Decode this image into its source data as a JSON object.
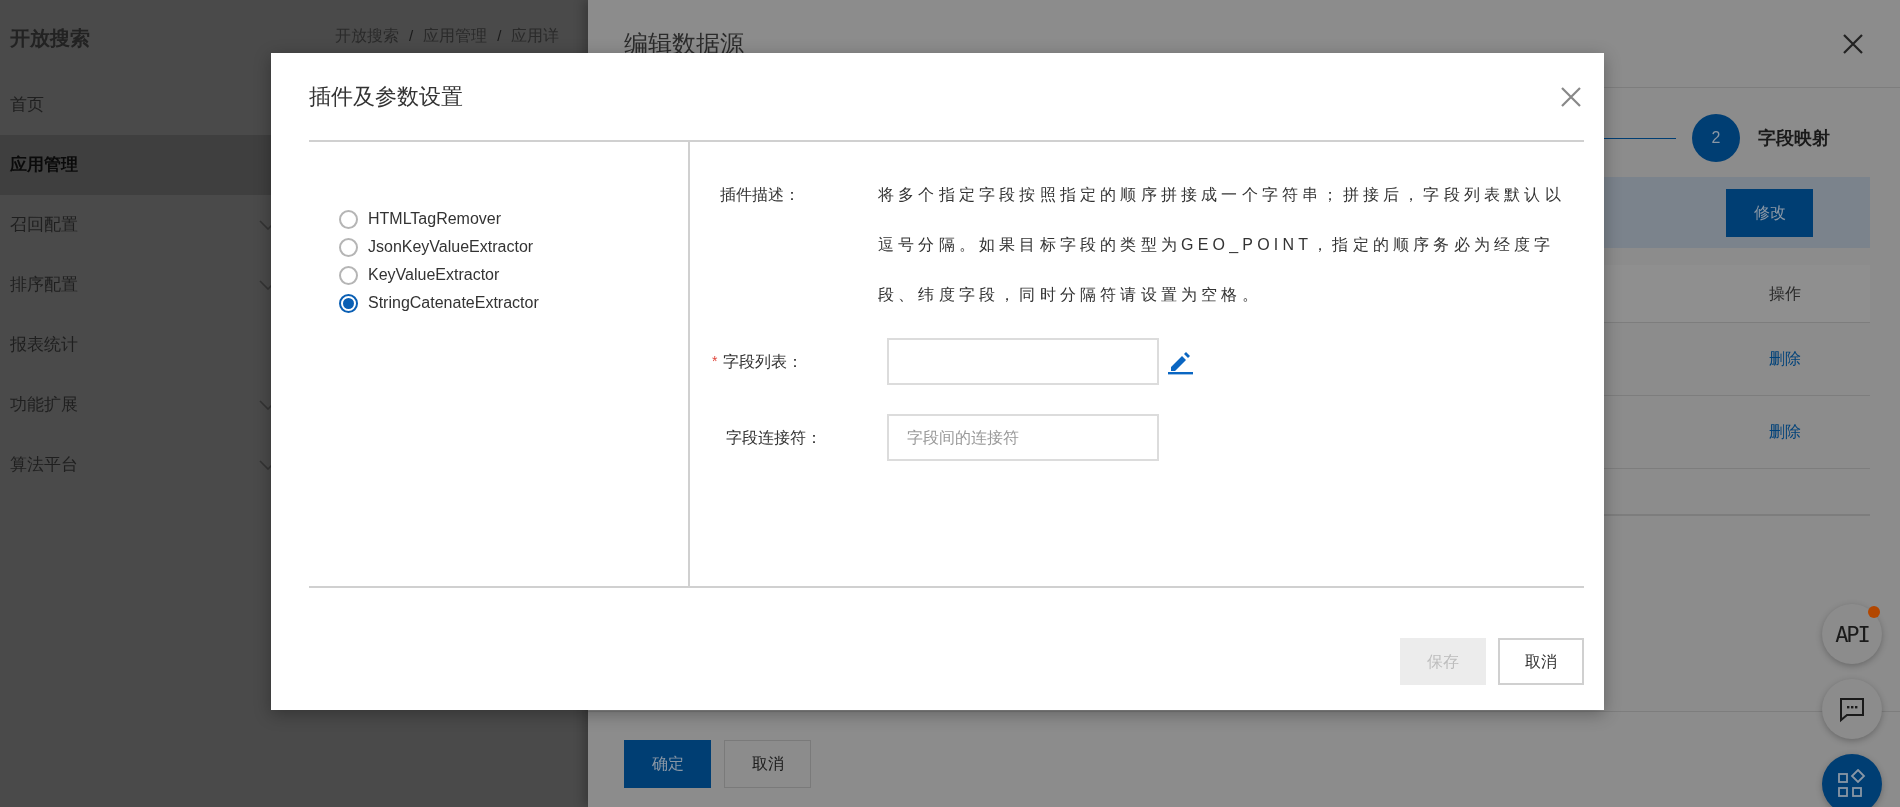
{
  "sidebar": {
    "title": "开放搜索",
    "items": [
      {
        "label": "首页",
        "selected": false,
        "expandable": false
      },
      {
        "label": "应用管理",
        "selected": true,
        "expandable": false
      },
      {
        "label": "召回配置",
        "selected": false,
        "expandable": true
      },
      {
        "label": "排序配置",
        "selected": false,
        "expandable": true
      },
      {
        "label": "报表统计",
        "selected": false,
        "expandable": false
      },
      {
        "label": "功能扩展",
        "selected": false,
        "expandable": true
      },
      {
        "label": "算法平台",
        "selected": false,
        "expandable": true
      }
    ]
  },
  "breadcrumb": {
    "separator": "/",
    "items": [
      "开放搜索",
      "应用管理",
      "应用详"
    ]
  },
  "drawer": {
    "title": "编辑数据源",
    "step": {
      "number": "2",
      "label": "字段映射"
    },
    "edit_button": "修改",
    "table": {
      "columns": [
        "操作"
      ],
      "rows": [
        {
          "action": "删除"
        },
        {
          "action": "删除"
        }
      ]
    },
    "footer_buttons": [
      {
        "label": "确定",
        "kind": "primary"
      },
      {
        "label": "取消",
        "kind": "secondary"
      }
    ]
  },
  "floating_buttons": [
    {
      "kind": "api",
      "label": "API",
      "badge": true
    },
    {
      "kind": "chat",
      "badge": false
    },
    {
      "kind": "apps",
      "badge": false
    }
  ],
  "dialog": {
    "title": "插件及参数设置",
    "plugins": [
      {
        "label": "HTMLTagRemover",
        "selected": false
      },
      {
        "label": "JsonKeyValueExtractor",
        "selected": false
      },
      {
        "label": "KeyValueExtractor",
        "selected": false
      },
      {
        "label": "StringCatenateExtractor",
        "selected": true
      }
    ],
    "description_label": "插件描述：",
    "description": "将多个指定字段按照指定的顺序拼接成一个字符串；拼接后，字段列表默认以逗号分隔。如果目标字段的类型为GEO_POINT，指定的顺序务必为经度字段、纬度字段，同时分隔符请设置为空格。",
    "fields": [
      {
        "label": "字段列表：",
        "required_mark": "*",
        "editable": true
      },
      {
        "label": "字段连接符：",
        "editable": false,
        "placeholder": "字段间的连接符"
      }
    ],
    "buttons": [
      {
        "label": "保存",
        "disabled": true
      },
      {
        "label": "取消",
        "disabled": false
      }
    ]
  }
}
